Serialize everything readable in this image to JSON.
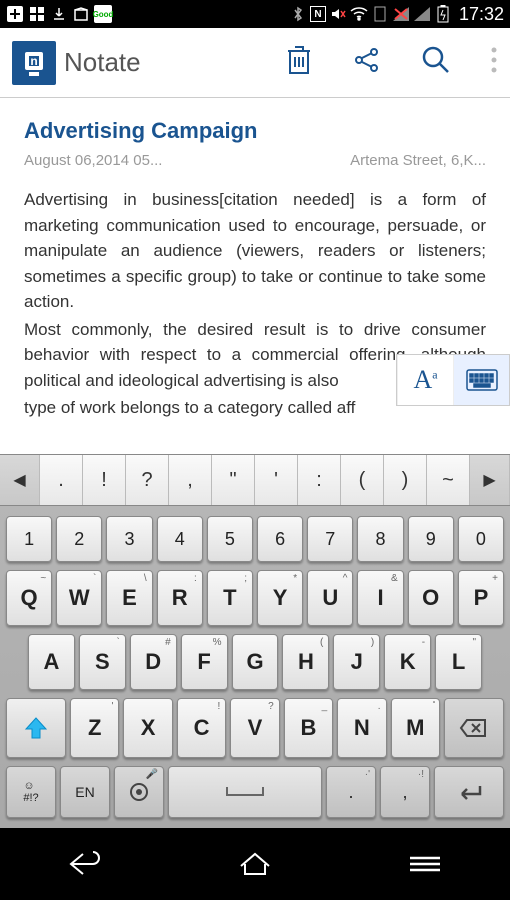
{
  "status": {
    "time": "17:32"
  },
  "header": {
    "title": "Notate"
  },
  "note": {
    "title": "Advertising Campaign",
    "date": "August 06,2014 05...",
    "location": "Artema Street, 6,K...",
    "para1": "Advertising in business[citation needed] is a form of marketing communication used to encourage, persuade, or manipulate an audience (viewers, readers or listeners; sometimes a specific group) to take or continue to take some action.",
    "para2": "Most commonly, the desired result is to drive consumer behavior with respect to a commercial offering, although political and ideological advertising is also",
    "para3": "type of work belongs to a category called aff"
  },
  "format": {
    "font_label": "Aᵃ"
  },
  "punct": [
    ".",
    "!",
    "?",
    ",",
    "\"",
    "'",
    ":",
    "(",
    ")",
    "~"
  ],
  "numbers": [
    "1",
    "2",
    "3",
    "4",
    "5",
    "6",
    "7",
    "8",
    "9",
    "0"
  ],
  "row1": [
    {
      "main": "Q",
      "sup": "~"
    },
    {
      "main": "W",
      "sup": "`"
    },
    {
      "main": "E",
      "sup": "\\"
    },
    {
      "main": "R",
      "sup": ":"
    },
    {
      "main": "T",
      "sup": ";"
    },
    {
      "main": "Y",
      "sup": "*"
    },
    {
      "main": "U",
      "sup": "^"
    },
    {
      "main": "I",
      "sup": "&"
    },
    {
      "main": "O",
      "sup": ""
    },
    {
      "main": "P",
      "sup": "+"
    }
  ],
  "row2": [
    {
      "main": "A",
      "sup": ""
    },
    {
      "main": "S",
      "sup": "`"
    },
    {
      "main": "D",
      "sup": "#"
    },
    {
      "main": "F",
      "sup": "%"
    },
    {
      "main": "G",
      "sup": ""
    },
    {
      "main": "H",
      "sup": "("
    },
    {
      "main": "J",
      "sup": ")"
    },
    {
      "main": "K",
      "sup": "-"
    },
    {
      "main": "L",
      "sup": "\""
    }
  ],
  "row3": [
    {
      "main": "Z",
      "sup": "'"
    },
    {
      "main": "X",
      "sup": ""
    },
    {
      "main": "C",
      "sup": "!"
    },
    {
      "main": "V",
      "sup": "?"
    },
    {
      "main": "B",
      "sup": "_"
    },
    {
      "main": "N",
      "sup": "."
    },
    {
      "main": "M",
      "sup": "̊"
    }
  ],
  "fn": {
    "sym": "☺\n#!?",
    "lang": "EN",
    "period": ".·'",
    "comma": ",·!"
  }
}
